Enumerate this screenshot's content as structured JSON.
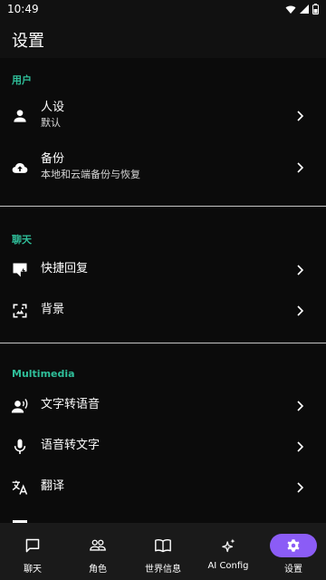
{
  "status_bar": {
    "time": "10:49",
    "icons": [
      "wifi-icon",
      "signal-icon",
      "battery-icon"
    ]
  },
  "app_bar": {
    "title": "设置"
  },
  "sections": [
    {
      "header": "用户",
      "items": [
        {
          "icon": "person-icon",
          "title": "人设",
          "subtitle": "默认"
        },
        {
          "icon": "cloud-upload-icon",
          "title": "备份",
          "subtitle": "本地和云端备份与恢复"
        }
      ]
    },
    {
      "header": "聊天",
      "items": [
        {
          "icon": "quick-reply-icon",
          "title": "快捷回复"
        },
        {
          "icon": "wallpaper-icon",
          "title": "背景"
        }
      ]
    },
    {
      "header": "Multimedia",
      "items": [
        {
          "icon": "record-voice-icon",
          "title": "文字转语音"
        },
        {
          "icon": "mic-icon",
          "title": "语音转文字"
        },
        {
          "icon": "translate-icon",
          "title": "翻译"
        }
      ]
    }
  ],
  "bottom_nav": {
    "items": [
      {
        "icon": "chat-icon",
        "label": "聊天"
      },
      {
        "icon": "people-icon",
        "label": "角色"
      },
      {
        "icon": "book-icon",
        "label": "世界信息"
      },
      {
        "icon": "sparkle-icon",
        "label": "AI Config"
      },
      {
        "icon": "gear-icon",
        "label": "设置",
        "active": true
      }
    ]
  },
  "colors": {
    "accent_section": "#2fbf9a",
    "active_nav": "#8b5cf6",
    "background": "#0b0b0b"
  }
}
